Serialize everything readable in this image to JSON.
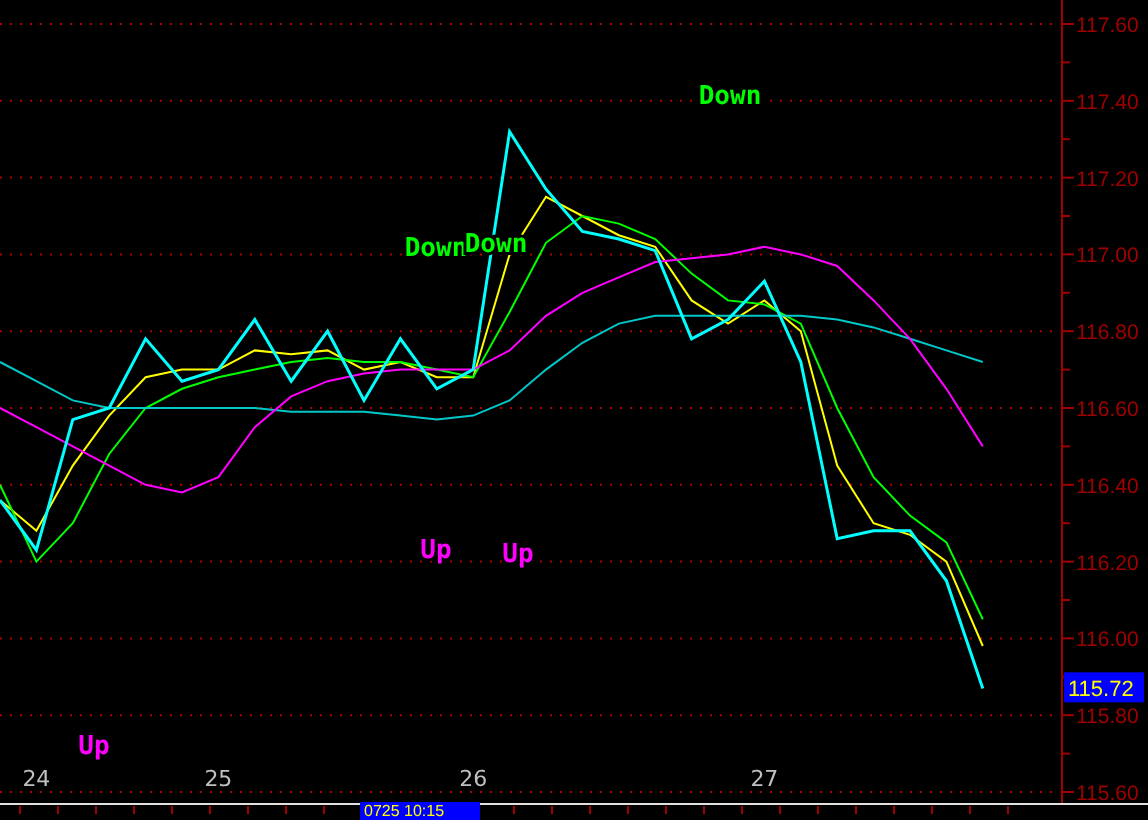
{
  "chart_data": {
    "type": "line",
    "categories": [
      null,
      "24",
      null,
      null,
      null,
      null,
      "25",
      null,
      null,
      null,
      null,
      null,
      null,
      "26",
      null,
      null,
      null,
      null,
      null,
      null,
      null,
      "27",
      null,
      null,
      null,
      null,
      null,
      null
    ],
    "ylim": [
      115.6,
      117.6
    ],
    "grid": true,
    "yticks": [
      {
        "value": 115.6,
        "label": "115.60"
      },
      {
        "value": 115.8,
        "label": "115.80"
      },
      {
        "value": 116,
        "label": "116.00"
      },
      {
        "value": 116.2,
        "label": "116.20"
      },
      {
        "value": 116.4,
        "label": "116.40"
      },
      {
        "value": 116.6,
        "label": "116.60"
      },
      {
        "value": 116.8,
        "label": "116.80"
      },
      {
        "value": 117,
        "label": "117.00"
      },
      {
        "value": 117.2,
        "label": "117.20"
      },
      {
        "value": 117.4,
        "label": "117.40"
      },
      {
        "value": 117.6,
        "label": "117.60"
      }
    ],
    "series": [
      {
        "color": "#00ffff",
        "values": [
          116.36,
          116.23,
          116.57,
          116.6,
          116.78,
          116.67,
          116.7,
          116.83,
          116.67,
          116.8,
          116.62,
          116.78,
          116.65,
          116.7,
          117.32,
          117.17,
          117.06,
          117.04,
          117.01,
          116.78,
          116.83,
          116.93,
          116.72,
          116.26,
          116.28,
          116.28,
          116.15,
          115.87
        ]
      },
      {
        "color": "#ffff00",
        "values": [
          116.36,
          116.28,
          116.45,
          116.58,
          116.68,
          116.7,
          116.7,
          116.75,
          116.74,
          116.75,
          116.7,
          116.72,
          116.68,
          116.68,
          117.0,
          117.15,
          117.1,
          117.05,
          117.02,
          116.88,
          116.82,
          116.88,
          116.8,
          116.45,
          116.3,
          116.27,
          116.2,
          115.98
        ]
      },
      {
        "color": "#00ff00",
        "values": [
          116.4,
          116.2,
          116.3,
          116.48,
          116.6,
          116.65,
          116.68,
          116.7,
          116.72,
          116.73,
          116.72,
          116.72,
          116.7,
          116.68,
          116.85,
          117.03,
          117.1,
          117.08,
          117.04,
          116.95,
          116.88,
          116.87,
          116.82,
          116.6,
          116.42,
          116.32,
          116.25,
          116.05
        ]
      },
      {
        "color": "#00c8c8",
        "values": [
          116.72,
          116.67,
          116.62,
          116.6,
          116.6,
          116.6,
          116.6,
          116.6,
          116.59,
          116.59,
          116.59,
          116.58,
          116.57,
          116.58,
          116.62,
          116.7,
          116.77,
          116.82,
          116.84,
          116.84,
          116.84,
          116.84,
          116.84,
          116.83,
          116.81,
          116.78,
          116.75,
          116.72
        ]
      },
      {
        "color": "#ff00ff",
        "values": [
          116.6,
          116.55,
          116.5,
          116.45,
          116.4,
          116.38,
          116.42,
          116.55,
          116.63,
          116.67,
          116.69,
          116.7,
          116.7,
          116.7,
          116.75,
          116.84,
          116.9,
          116.94,
          116.98,
          116.99,
          117.0,
          117.02,
          117.0,
          116.97,
          116.88,
          116.78,
          116.65,
          116.5
        ]
      }
    ]
  },
  "signals": [
    {
      "text": "Down",
      "color": "#00ff00"
    },
    {
      "text": "Down",
      "color": "#00ff00"
    },
    {
      "text": "Down",
      "color": "#00ff00"
    },
    {
      "text": "Up",
      "color": "#ff00ff"
    },
    {
      "text": "Up",
      "color": "#ff00ff"
    },
    {
      "text": "Up",
      "color": "#ff00ff"
    }
  ],
  "last_price": "115.72",
  "cursor_time": "0725 10:15"
}
